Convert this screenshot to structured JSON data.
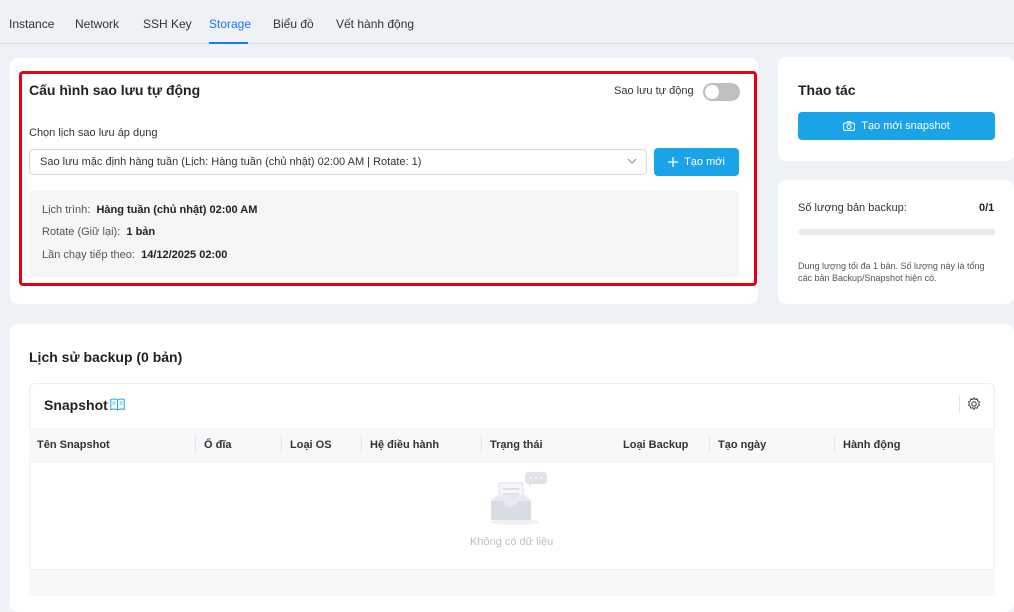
{
  "tabs": [
    {
      "label": "Instance"
    },
    {
      "label": "Network"
    },
    {
      "label": "SSH Key"
    },
    {
      "label": "Storage"
    },
    {
      "label": "Biểu đồ"
    },
    {
      "label": "Vết hành động"
    }
  ],
  "active_tab": "Storage",
  "backup_config": {
    "title": "Cấu hình sao lưu tự động",
    "toggle_label": "Sao lưu tự động",
    "toggle_on": false,
    "schedule_label": "Chọn lịch sao lưu áp dụng",
    "schedule_value": "Sao lưu mặc định hàng tuần (Lịch: Hàng tuần (chủ nhật) 02:00 AM | Rotate: 1)",
    "create_button": "Tạo mới",
    "details": {
      "schedule_label": "Lịch trình:",
      "schedule_value": "Hàng tuần (chủ nhật) 02:00 AM",
      "rotate_label": "Rotate (Giữ lại):",
      "rotate_value": "1 bản",
      "next_run_label": "Lần chạy tiếp theo:",
      "next_run_value": "14/12/2025 02:00"
    }
  },
  "actions": {
    "title": "Thao tác",
    "snapshot_button": "Tạo mới snapshot"
  },
  "backup_count": {
    "label": "Số lượng bản backup:",
    "value": "0/1",
    "progress_fraction": 0,
    "note": "Dung lượng tối đa 1 bản. Số lượng này là tổng các bản Backup/Snapshot hiện có."
  },
  "history": {
    "title": "Lịch sử backup (0 bản)",
    "table_title": "Snapshot",
    "columns": [
      "Tên Snapshot",
      "Ổ đĩa",
      "Loại OS",
      "Hệ điều hành",
      "Trạng thái",
      "Loại Backup",
      "Tạo ngày",
      "Hành động"
    ],
    "empty_text": "Không có dữ liệu"
  },
  "colors": {
    "accent": "#1677ff",
    "button": "#1aa3e8",
    "highlight_frame": "#e60012"
  }
}
